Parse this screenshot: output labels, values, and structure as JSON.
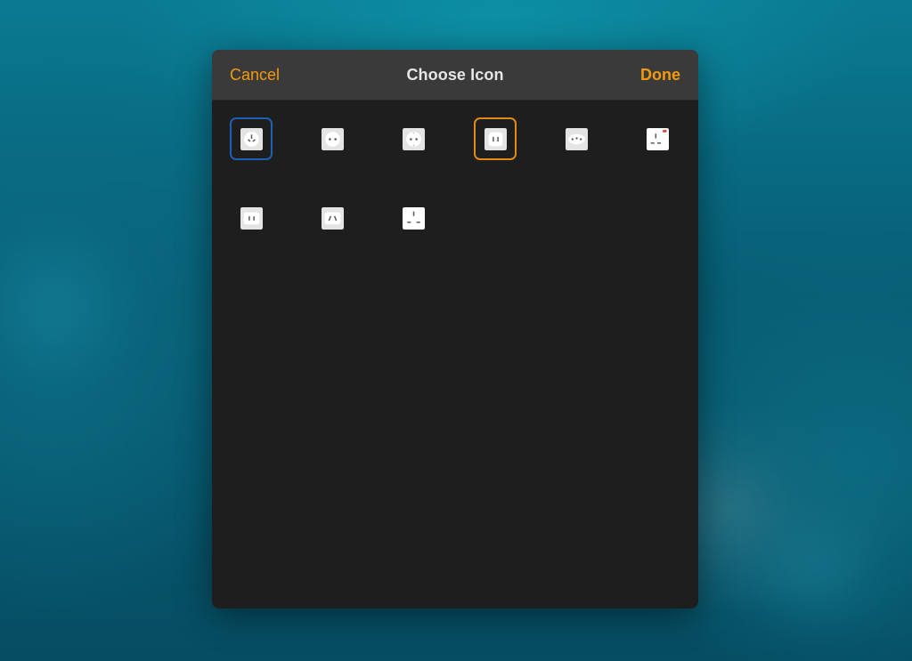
{
  "dialog": {
    "title": "Choose Icon",
    "cancel_label": "Cancel",
    "done_label": "Done"
  },
  "colors": {
    "accent": "#f29a0f",
    "selected_primary": "#1d5fb3",
    "selected_secondary": "#e08a12",
    "panel": "#1e1e1e",
    "titlebar": "#3a3a3a"
  },
  "icons": [
    {
      "name": "outlet-type-i-icon",
      "selection": "blue"
    },
    {
      "name": "outlet-type-c-icon",
      "selection": "none"
    },
    {
      "name": "outlet-type-f-icon",
      "selection": "none"
    },
    {
      "name": "outlet-type-a-icon",
      "selection": "orange"
    },
    {
      "name": "outlet-type-l-icon",
      "selection": "none"
    },
    {
      "name": "outlet-type-g-switched-icon",
      "selection": "none"
    },
    {
      "name": "outlet-type-a-alt-icon",
      "selection": "none"
    },
    {
      "name": "outlet-type-i-alt-icon",
      "selection": "none"
    },
    {
      "name": "outlet-type-g-icon",
      "selection": "none"
    }
  ]
}
